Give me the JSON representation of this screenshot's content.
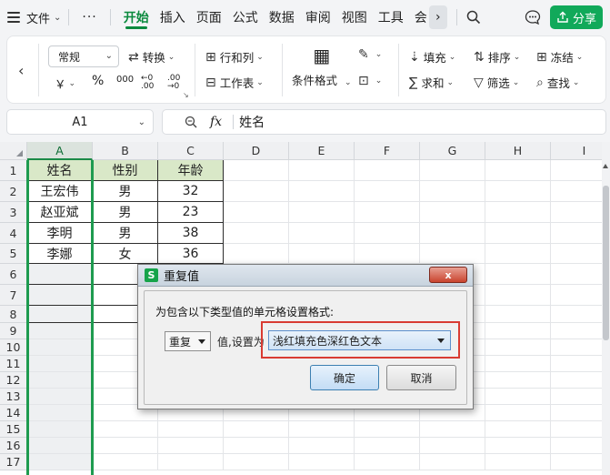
{
  "menubar": {
    "file_label": "文件",
    "more_label": "···",
    "tabs": [
      "开始",
      "插入",
      "页面",
      "公式",
      "数据",
      "审阅",
      "视图",
      "工具",
      "会"
    ],
    "active_tab": "开始",
    "share_label": "分享"
  },
  "ribbon": {
    "number_format": "常规",
    "convert_label": "转换",
    "rows_cols_label": "行和列",
    "worksheet_label": "工作表",
    "cond_format_label": "条件格式",
    "fill_label": "填充",
    "sort_label": "排序",
    "freeze_label": "冻结",
    "sum_label": "求和",
    "filter_label": "筛选",
    "find_label": "查找",
    "currency_symbol": "￥",
    "percent_symbol": "%",
    "thousands_symbol": "000",
    "inc_decimal_symbol": "←0 .00",
    "dec_decimal_symbol": ".00 →0"
  },
  "formula_bar": {
    "cell_ref": "A1",
    "fx_label": "fx",
    "value": "姓名"
  },
  "grid": {
    "columns": [
      "A",
      "B",
      "C",
      "D",
      "E",
      "F",
      "G",
      "H",
      "I"
    ],
    "rows": [
      "1",
      "2",
      "3",
      "4",
      "5",
      "6",
      "7",
      "8",
      "9",
      "10",
      "11",
      "12",
      "13",
      "14",
      "15",
      "16",
      "17"
    ],
    "headers": [
      "姓名",
      "性别",
      "年龄"
    ],
    "data": [
      [
        "王宏伟",
        "男",
        "32"
      ],
      [
        "赵亚斌",
        "男",
        "23"
      ],
      [
        "李明",
        "男",
        "38"
      ],
      [
        "李娜",
        "女",
        "36"
      ]
    ]
  },
  "dialog": {
    "title": "重复值",
    "close_label": "x",
    "prompt": "为包含以下类型值的单元格设置格式:",
    "type_value": "重复",
    "value_label": "值,设置为",
    "format_value": "浅红填充色深红色文本",
    "ok_label": "确定",
    "cancel_label": "取消"
  },
  "colors": {
    "accent": "#0b8a3e",
    "share": "#11a95a",
    "header_fill": "#d9e8c8",
    "highlight": "#d93b32"
  }
}
